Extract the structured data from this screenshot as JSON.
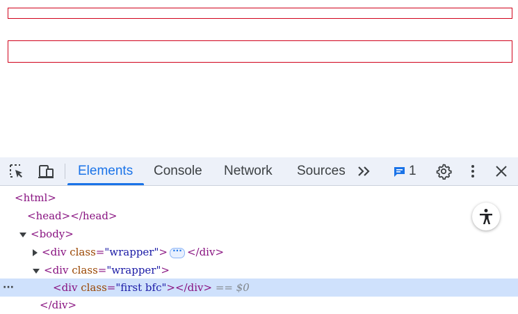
{
  "devtools": {
    "tabs": [
      "Elements",
      "Console",
      "Network",
      "Sources"
    ],
    "active_tab": "Elements",
    "issues_count": "1",
    "icons": [
      "inspect-element-icon",
      "device-toolbar-icon",
      "more-tabs-icon",
      "issues-icon",
      "settings-icon",
      "more-options-icon",
      "close-icon",
      "accessibility-icon"
    ]
  },
  "tree": {
    "html_open": "<html>",
    "head": "<head></head>",
    "body_open": "<body>",
    "div": "div",
    "class_attr": "class",
    "wrapper_value": "\"wrapper\"",
    "first_bfc_value": "\"first bfc\"",
    "close_div": "</div>",
    "eq_dollar": "== $0"
  }
}
